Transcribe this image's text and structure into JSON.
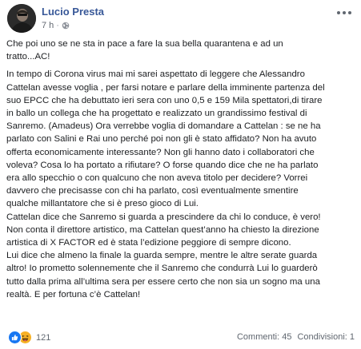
{
  "post": {
    "author": "Lucio Presta",
    "time": "7 h",
    "separator": "·",
    "paragraphs": [
      "Che poi uno se ne sta in pace a fare la sua bella quarantena e ad un\ntratto...AC!",
      "In tempo di Corona virus mai mi sarei aspettato di leggere che Alessandro\nCattelan avesse voglia , per farsi notare e parlare della imminente partenza del\nsuo EPCC che ha debuttato ieri sera con uno 0,5 e 159 Mila spettatori,di tirare\nin ballo un collega che ha progettato e realizzato un grandissimo festival di\nSanremo. (Amadeus) Ora verrebbe voglia di domandare a Cattelan : se ne ha\nparlato con Salini e Rai uno perché poi non gli è stato affidato? Non ha avuto\nofferta economicamente interessante? Non gli hanno dato i collaboratori che\nvoleva? Cosa lo ha portato a rifiutare? O forse quando dice che ne ha parlato\nera allo specchio o con qualcuno che non aveva titolo per decidere? Vorrei\ndavvero che precisasse con chi ha parlato, così eventualmente smentire\nqualche millantatore che si è preso gioco di Lui.\nCattelan dice che Sanremo si guarda a prescindere da chi lo conduce, è vero!\nNon conta il direttore artistico, ma Cattelan quest’anno ha chiesto la direzione\nartistica di X FACTOR ed è stata l’edizione peggiore di sempre dicono.\nLui dice che almeno la finale la guarda sempre, mentre le altre serate guarda\naltro! Io prometto solennemente che il Sanremo che condurrà Lui lo guarderò\ntutto dalla prima all’ultima sera per essere certo che non sia un sogno ma una\nrealtà. E per fortuna c’è Cattelan!"
    ]
  },
  "footer": {
    "reaction_count": "121",
    "comments_label": "Commenti: 45",
    "shares_label": "Condivisioni: 1"
  },
  "icons": {
    "privacy": "globe-icon",
    "menu": "more-options-icon",
    "reactions": [
      "like-icon",
      "haha-icon"
    ]
  },
  "colors": {
    "author_link": "#385898",
    "meta_text": "#616770",
    "like_blue": "#1877f2",
    "haha_yellow": "#f7b125"
  }
}
